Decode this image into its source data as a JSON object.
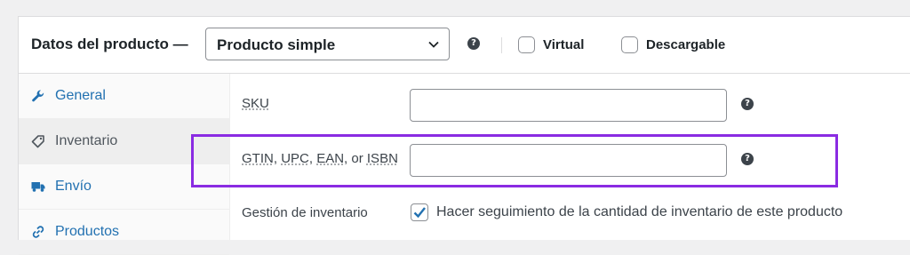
{
  "header": {
    "title": "Datos del producto —",
    "product_type": {
      "selected": "Producto simple",
      "icon": "chevron-down-icon"
    },
    "help_icon": "question-circle-icon",
    "virtual_label": "Virtual",
    "virtual_checked": false,
    "downloadable_label": "Descargable",
    "downloadable_checked": false
  },
  "sidebar": {
    "items": [
      {
        "label": "General",
        "icon": "wrench-icon",
        "active": false
      },
      {
        "label": "Inventario",
        "icon": "tag-icon",
        "active": true
      },
      {
        "label": "Envío",
        "icon": "truck-icon",
        "active": false
      },
      {
        "label": "Productos",
        "icon": "link-icon",
        "active": false
      }
    ]
  },
  "main": {
    "sku": {
      "label": "SKU",
      "value": ""
    },
    "gtin": {
      "label_parts": [
        "GTIN",
        ", ",
        "UPC",
        ", ",
        "EAN",
        ", or ",
        "ISBN"
      ],
      "value": ""
    },
    "stock": {
      "label": "Gestión de inventario",
      "checkbox_label": "Hacer seguimiento de la cantidad de inventario de este producto",
      "checked": true
    }
  },
  "colors": {
    "accent": "#2271b1",
    "highlight": "#8a2be2",
    "border": "#8c8f94"
  }
}
